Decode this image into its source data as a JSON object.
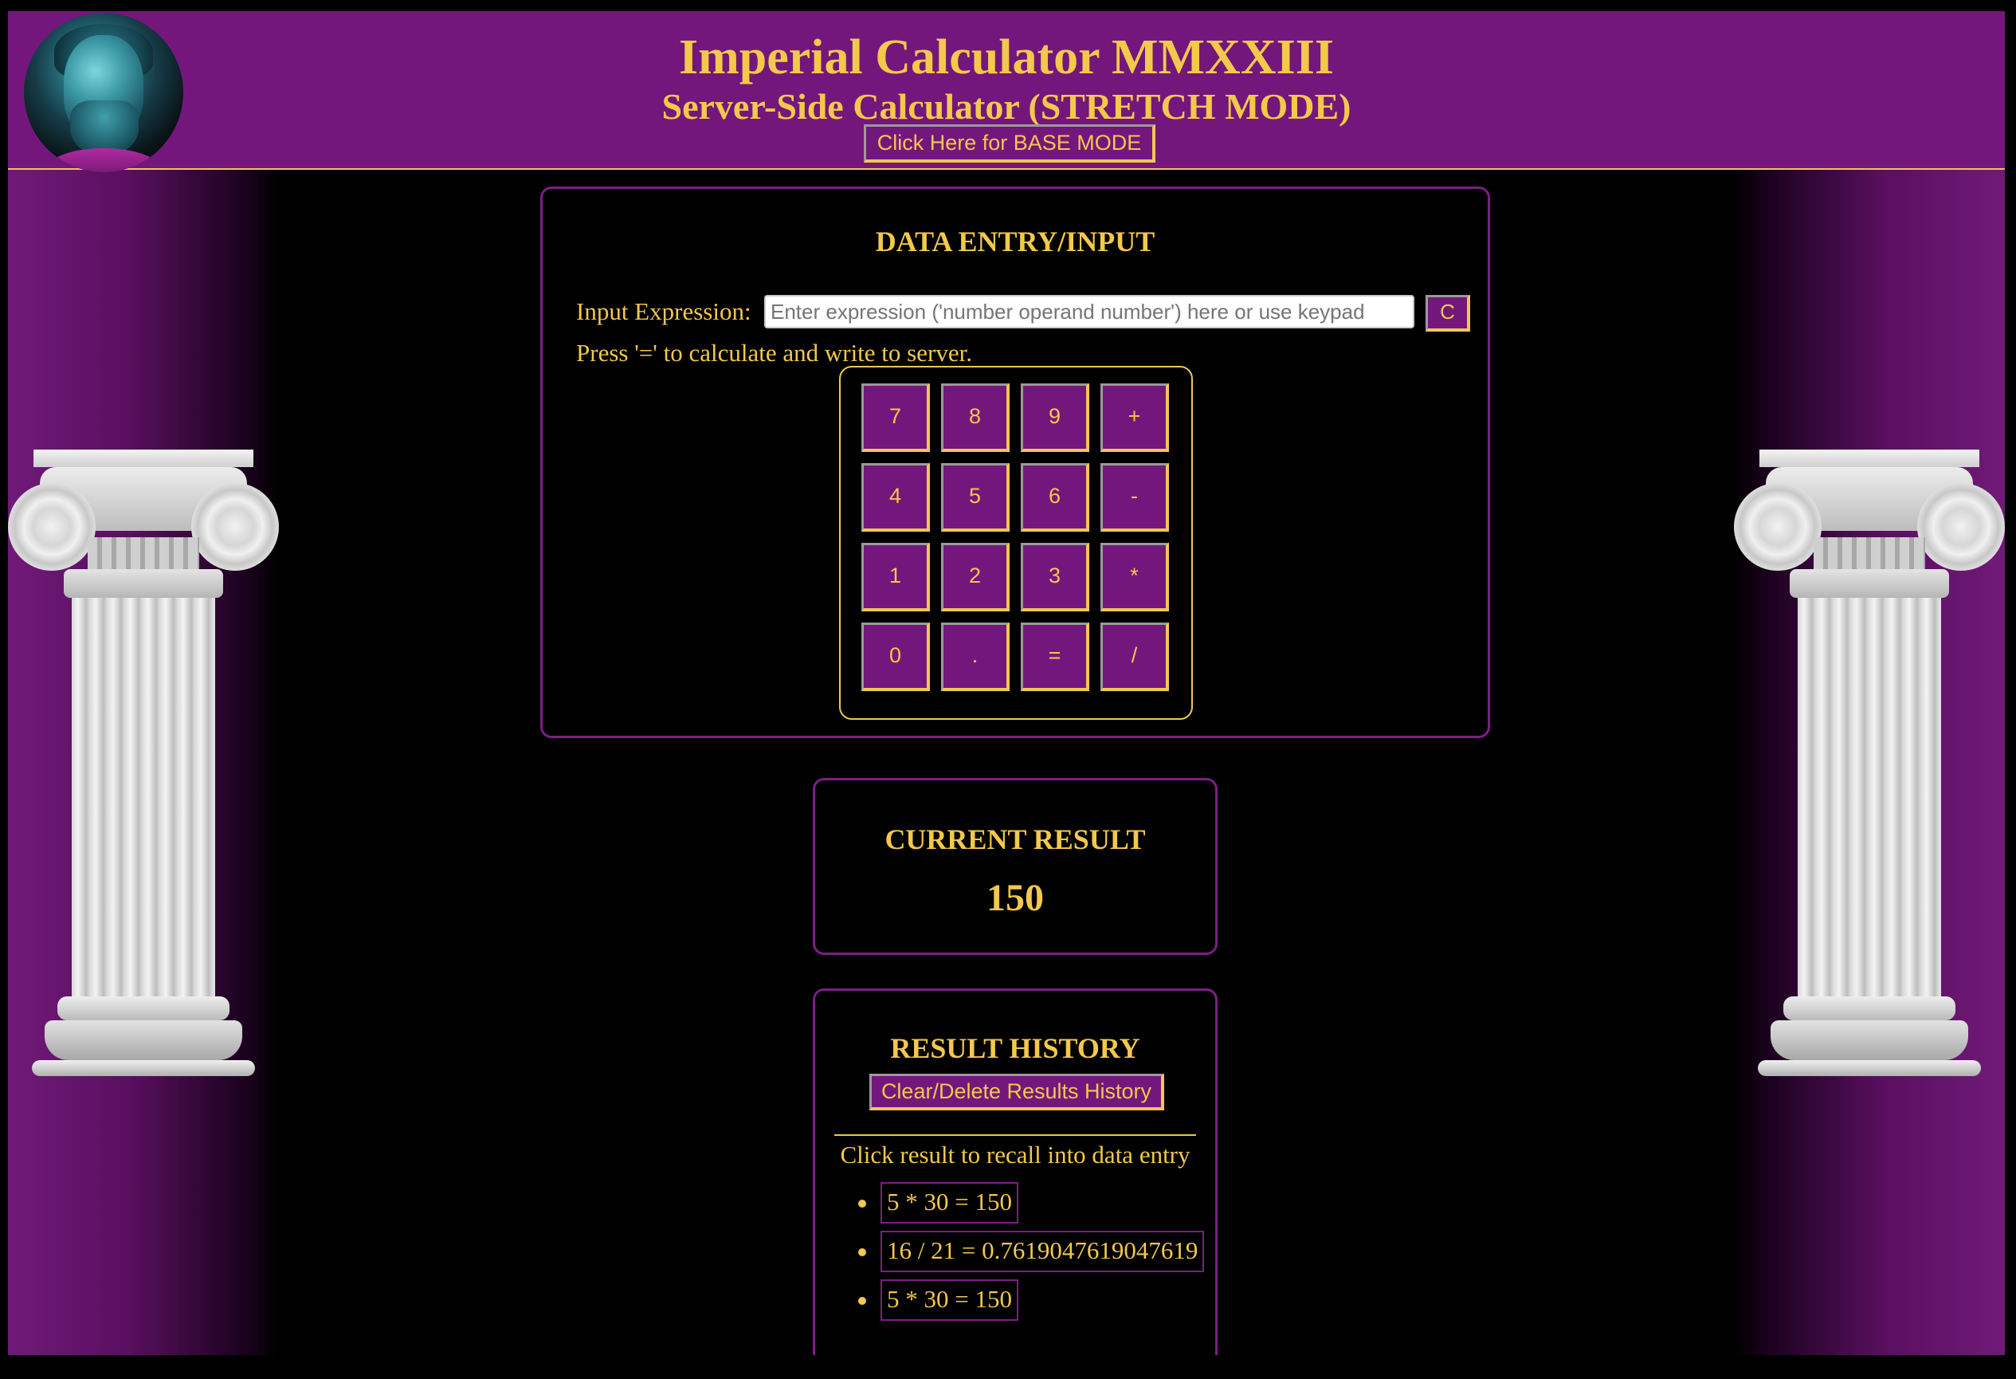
{
  "header": {
    "title": "Imperial Calculator MMXXIII",
    "subtitle": "Server-Side Calculator (STRETCH MODE)",
    "mode_button": "Click Here for BASE MODE"
  },
  "entry": {
    "heading": "DATA ENTRY/INPUT",
    "input_label": "Input Expression:",
    "input_value": "",
    "input_placeholder": "Enter expression ('number operand number') here or use keypad",
    "clear_button": "C",
    "hint": "Press '=' to calculate and write to server.",
    "keys": [
      "7",
      "8",
      "9",
      "+",
      "4",
      "5",
      "6",
      "-",
      "1",
      "2",
      "3",
      "*",
      "0",
      ".",
      "=",
      "/"
    ]
  },
  "result": {
    "heading": "CURRENT RESULT",
    "value": "150"
  },
  "history": {
    "heading": "RESULT HISTORY",
    "clear_button": "Clear/Delete Results History",
    "caption": "Click result to recall into data entry",
    "items": [
      "5 * 30 = 150",
      "16 / 21 = 0.7619047619047619",
      "5 * 30 = 150"
    ]
  },
  "icons": {
    "avatar": "emperor-bust-portrait",
    "decor_left": "ionic-column-left",
    "decor_right": "ionic-column-right"
  },
  "colors": {
    "brand_purple": "#74177c",
    "accent_gold": "#f3c84b",
    "panel_border": "#7c1f86",
    "background": "#000000"
  }
}
